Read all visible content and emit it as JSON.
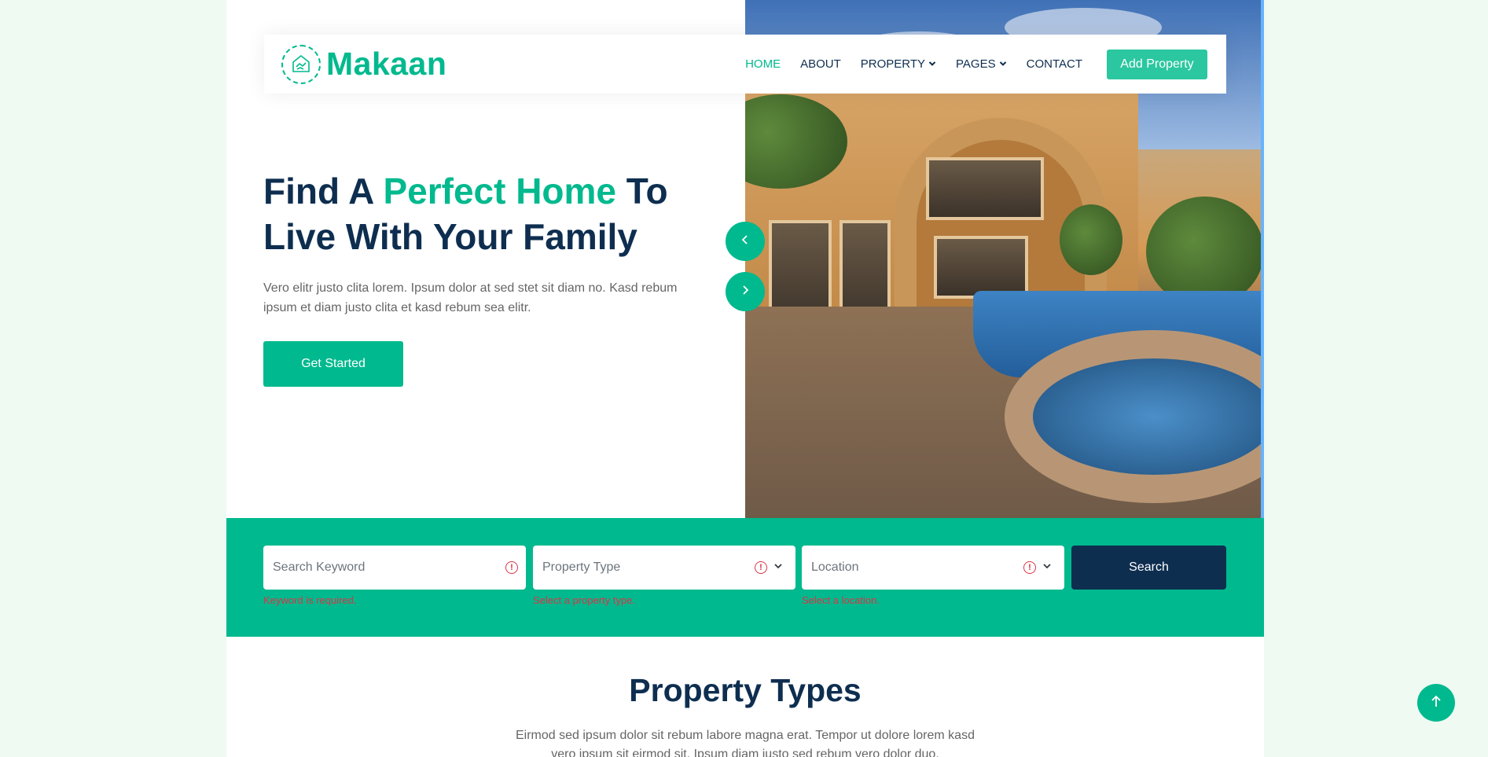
{
  "brand": {
    "name": "Makaan",
    "icon": "handshake-house-icon"
  },
  "nav": {
    "items": [
      {
        "label": "HOME",
        "active": true
      },
      {
        "label": "ABOUT"
      },
      {
        "label": "PROPERTY",
        "dropdown": true
      },
      {
        "label": "PAGES",
        "dropdown": true
      },
      {
        "label": "CONTACT"
      }
    ],
    "cta": "Add Property"
  },
  "hero": {
    "title_part1": "Find A ",
    "title_accent": "Perfect Home",
    "title_part2": " To Live With Your Family",
    "description": "Vero elitr justo clita lorem. Ipsum dolor at sed stet sit diam no. Kasd rebum ipsum et diam justo clita et kasd rebum sea elitr.",
    "button": "Get Started",
    "image": "luxury-house-with-pool"
  },
  "search": {
    "keyword": {
      "placeholder": "Search Keyword",
      "error": "Keyword is required."
    },
    "property_type": {
      "placeholder": "Property Type",
      "error": "Select a property type."
    },
    "location": {
      "placeholder": "Location",
      "error": "Select a location."
    },
    "button": "Search"
  },
  "section": {
    "title": "Property Types",
    "description": "Eirmod sed ipsum dolor sit rebum labore magna erat. Tempor ut dolore lorem kasd vero ipsum sit eirmod sit. Ipsum diam justo sed rebum vero dolor duo."
  },
  "colors": {
    "primary": "#00b98e",
    "dark": "#0e2e50",
    "error": "#dc3545",
    "page_bg": "#eefaf2"
  }
}
